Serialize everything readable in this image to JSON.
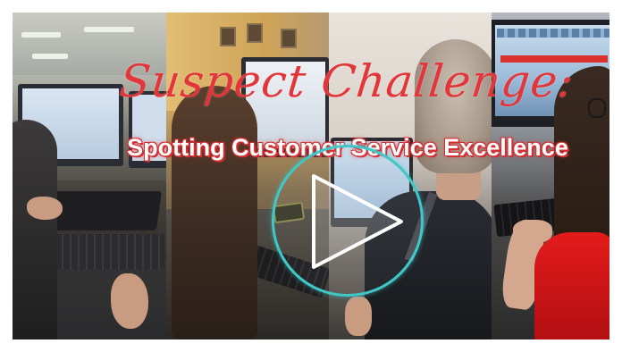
{
  "video": {
    "title_script": "Suspect Challenge:",
    "subtitle": "Spotting Customer Service Excellence"
  },
  "controls": {
    "play_icon": "play-icon"
  },
  "colors": {
    "title_red": "#e3363b",
    "subtitle_outline": "#d32f32",
    "play_ring": "#40c8c8"
  }
}
